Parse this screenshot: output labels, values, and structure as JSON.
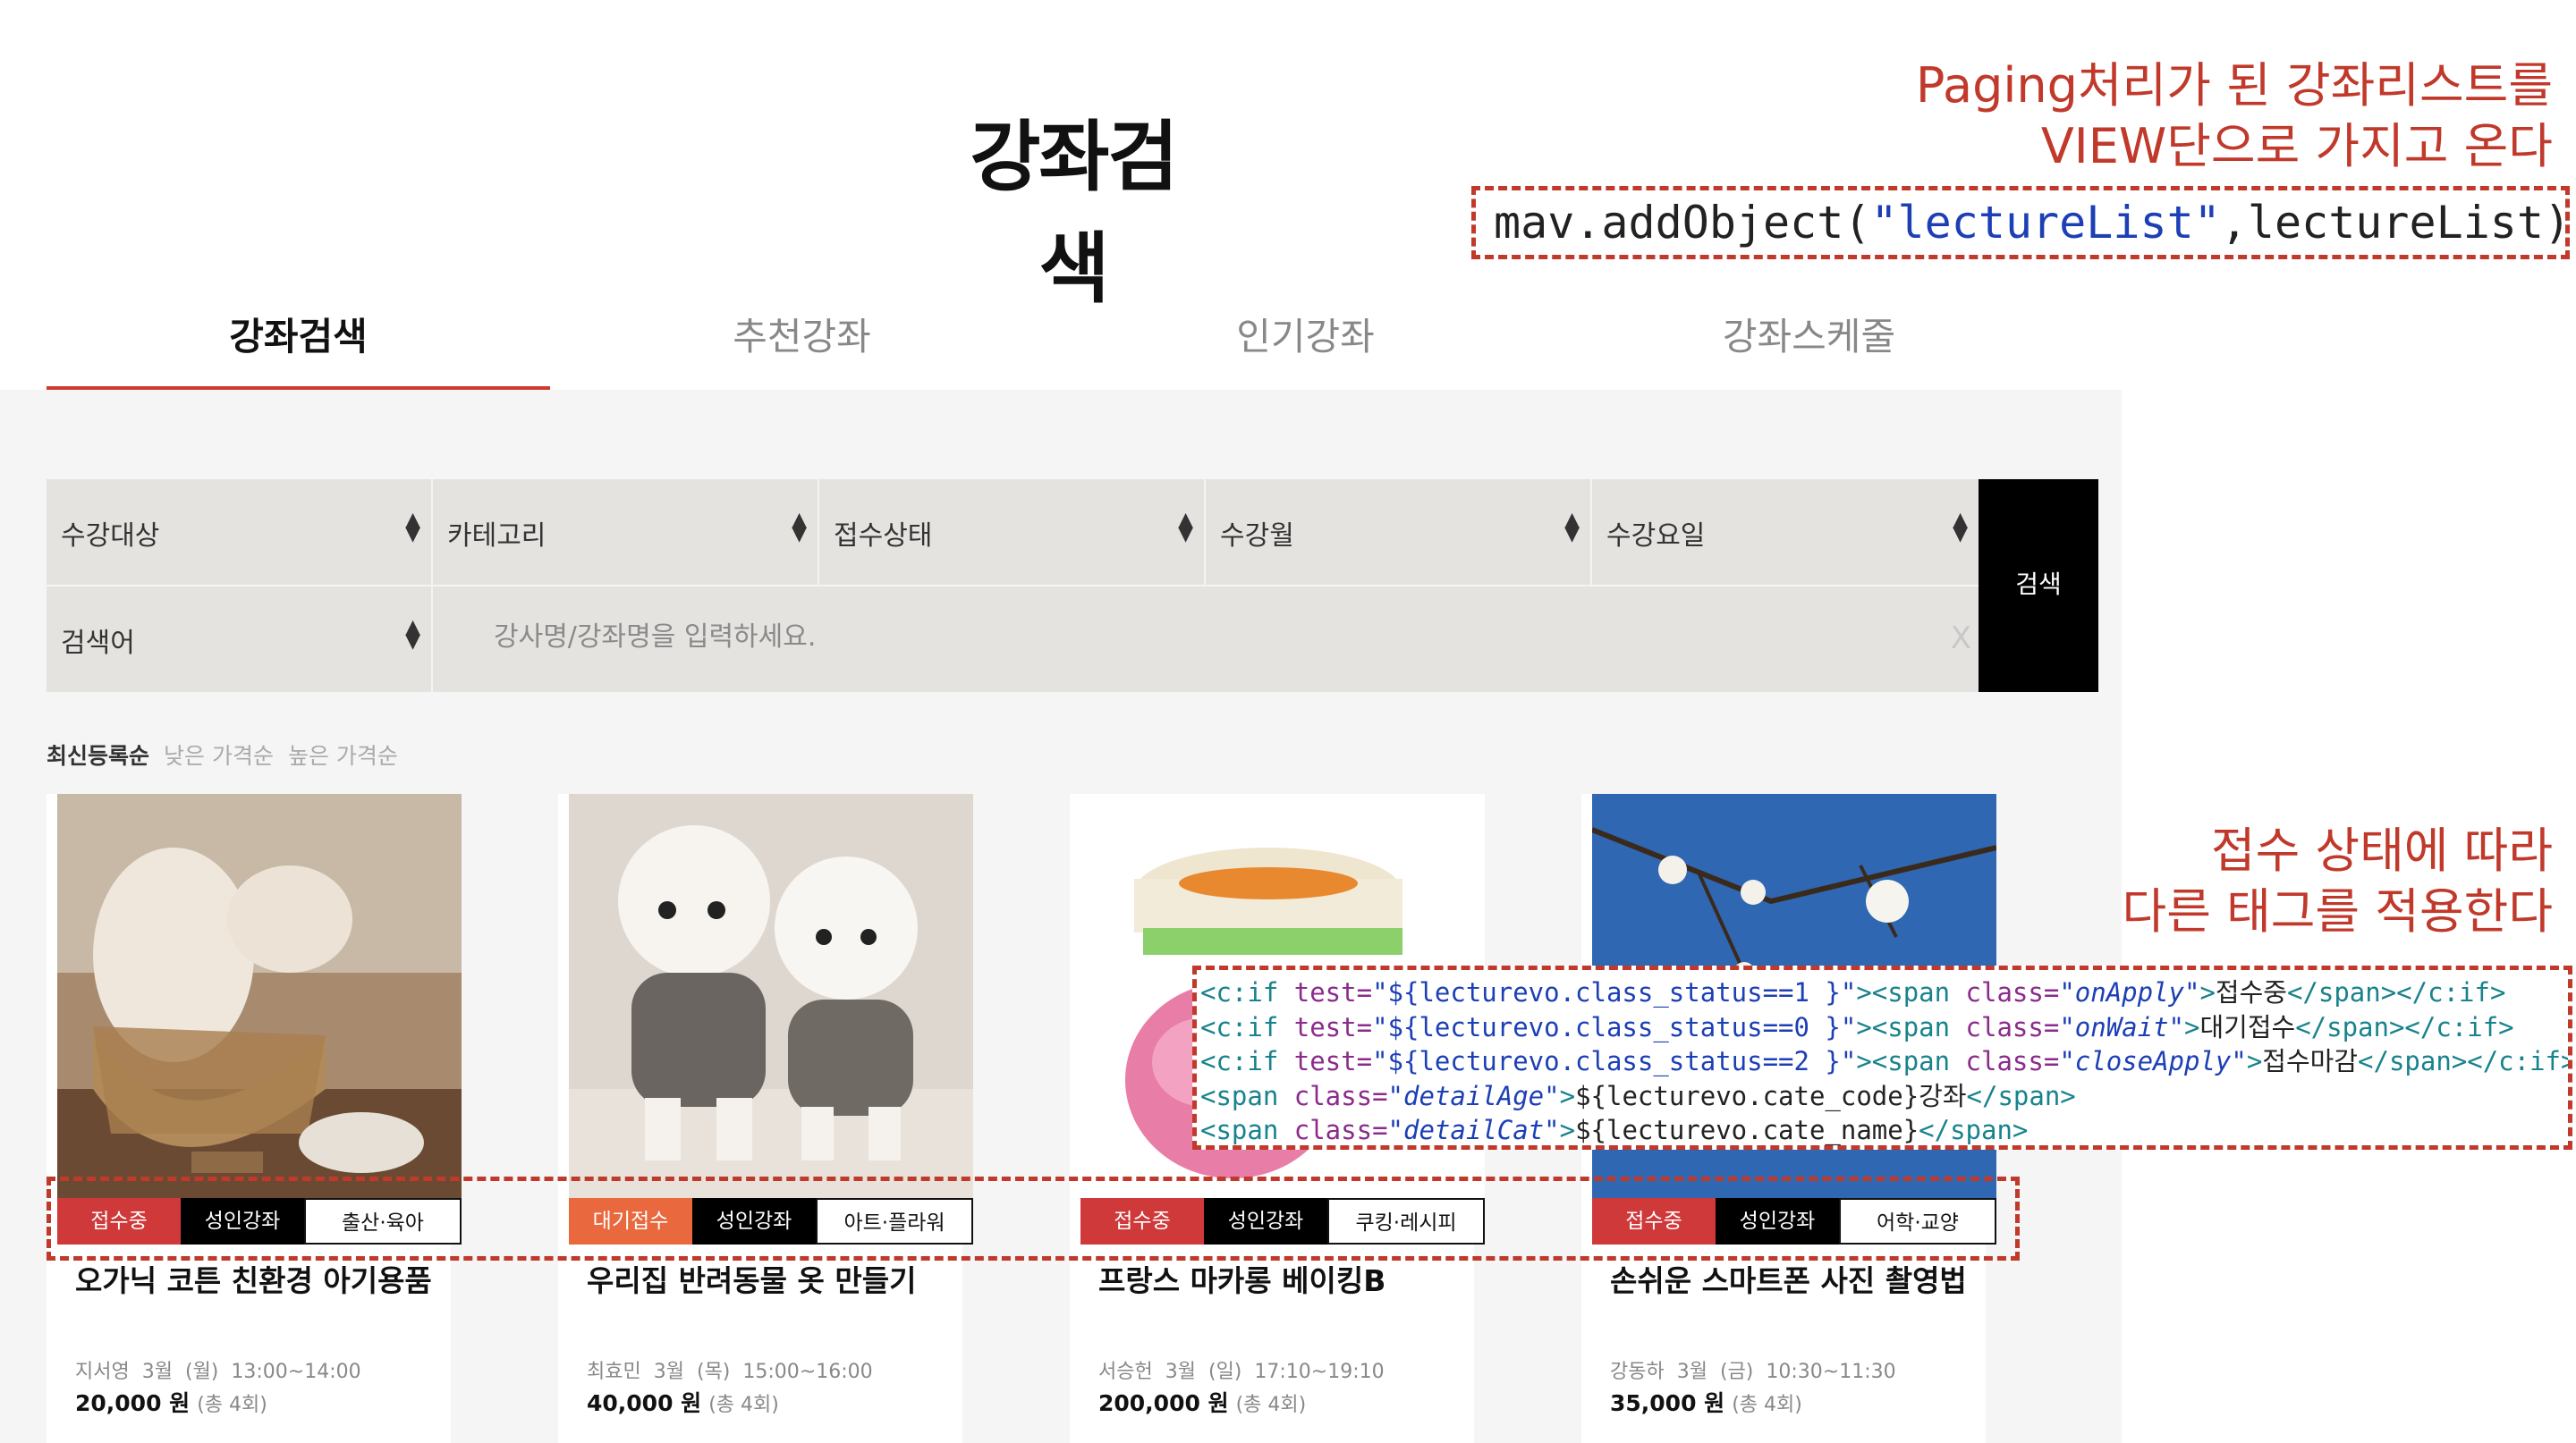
{
  "page": {
    "title": "강좌검색"
  },
  "annotations": {
    "top": [
      "Paging처리가 된 강좌리스트를",
      "VIEW단으로 가지고 온다"
    ],
    "top_code": {
      "p1": "mav.addObject(",
      "p2": "\"lectureList\"",
      "p3": ",lectureList);"
    },
    "middle": [
      "접수 상태에 따라",
      "다른 태그를 적용한다"
    ],
    "code_lines": [
      {
        "a": "<c:if ",
        "b": "test=",
        "c": "\"${lecturevo.class_status==1 }\"",
        "d": "><span ",
        "e": "class=",
        "f": "\"onApply\"",
        "g": ">",
        "h": "접수중",
        "i": "</span></c:if>"
      },
      {
        "a": "<c:if ",
        "b": "test=",
        "c": "\"${lecturevo.class_status==0 }\"",
        "d": "><span ",
        "e": "class=",
        "f": "\"onWait\"",
        "g": ">",
        "h": "대기접수",
        "i": "</span></c:if>"
      },
      {
        "a": "<c:if ",
        "b": "test=",
        "c": "\"${lecturevo.class_status==2 }\"",
        "d": "><span ",
        "e": "class=",
        "f": "\"closeApply\"",
        "g": ">",
        "h": "접수마감",
        "i": "</span></c:if>"
      },
      {
        "a": "<span ",
        "b": "class=",
        "c": "\"detailAge\"",
        "d": ">",
        "e": "${lecturevo.cate_code}강좌",
        "f": "</span>"
      },
      {
        "a": "<span ",
        "b": "class=",
        "c": "\"detailCat\"",
        "d": ">",
        "e": "${lecturevo.cate_name}",
        "f": "</span>"
      }
    ]
  },
  "tabs": [
    "강좌검색",
    "추천강좌",
    "인기강좌",
    "강좌스케줄"
  ],
  "filters": {
    "selects": [
      "수강대상",
      "카테고리",
      "접수상태",
      "수강월",
      "수강요일"
    ],
    "keyword_select": "검색어",
    "search_placeholder": "강사명/강좌명을 입력하세요.",
    "clear": "X",
    "search_button": "검색"
  },
  "sort": [
    "최신등록순",
    "낮은 가격순",
    "높은 가격순"
  ],
  "cards": [
    {
      "status": "접수중",
      "status_color": "#d0393a",
      "age": "성인강좌",
      "category": "출산·육아",
      "title": "오가닉 코튼 친환경 아기용품",
      "teacher": "지서영",
      "month": "3월",
      "day": "(월)",
      "time": "13:00~14:00",
      "price": "20,000 원",
      "total": "(총 4회)"
    },
    {
      "status": "대기접수",
      "status_color": "#e9683d",
      "age": "성인강좌",
      "category": "아트·플라워",
      "title": "우리집 반려동물 옷 만들기",
      "teacher": "최효민",
      "month": "3월",
      "day": "(목)",
      "time": "15:00~16:00",
      "price": "40,000 원",
      "total": "(총 4회)"
    },
    {
      "status": "접수중",
      "status_color": "#d0393a",
      "age": "성인강좌",
      "category": "쿠킹·레시피",
      "title": "프랑스 마카롱 베이킹B",
      "teacher": "서승헌",
      "month": "3월",
      "day": "(일)",
      "time": "17:10~19:10",
      "price": "200,000 원",
      "total": "(총 4회)"
    },
    {
      "status": "접수중",
      "status_color": "#d0393a",
      "age": "성인강좌",
      "category": "어학·교양",
      "title": "손쉬운 스마트폰 사진 촬영법",
      "teacher": "강동하",
      "month": "3월",
      "day": "(금)",
      "time": "10:30~11:30",
      "price": "35,000 원",
      "total": "(총 4회)"
    }
  ]
}
